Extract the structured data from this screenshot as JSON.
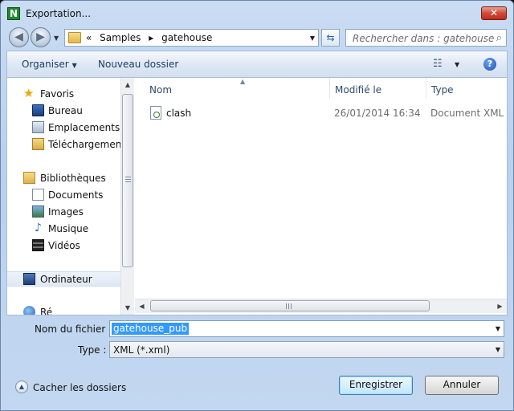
{
  "window": {
    "title": "Exportation...",
    "app_icon_letter": "N",
    "close_label": "✕"
  },
  "address": {
    "prefix": "«",
    "crumbs": [
      "Samples",
      "gatehouse"
    ],
    "separator": "▸"
  },
  "search": {
    "placeholder": "Rechercher dans : gatehouse"
  },
  "toolbar": {
    "organiser_label": "Organiser",
    "new_folder_label": "Nouveau dossier"
  },
  "nav": {
    "favorites": "Favoris",
    "favorites_items": [
      "Bureau",
      "Emplacements ré",
      "Téléchargements"
    ],
    "libraries": "Bibliothèques",
    "libraries_items": [
      "Documents",
      "Images",
      "Musique",
      "Vidéos"
    ],
    "computer": "Ordinateur",
    "network": "Ré"
  },
  "files": {
    "columns": [
      "Nom",
      "Modifié le",
      "Type"
    ],
    "rows": [
      {
        "name": "clash",
        "modified": "26/01/2014 16:34",
        "type": "Document XML"
      }
    ]
  },
  "form": {
    "filename_label": "Nom du fichier :",
    "filename_value": "gatehouse_pub",
    "type_label": "Type :",
    "type_value": "XML (*.xml)"
  },
  "footer": {
    "hide_folders_label": "Cacher les dossiers",
    "save_label": "Enregistrer",
    "cancel_label": "Annuler"
  },
  "colors": {
    "selection": "#3399ff",
    "close_button": "#c02d1c",
    "window_frame": "#b9d1ee"
  }
}
